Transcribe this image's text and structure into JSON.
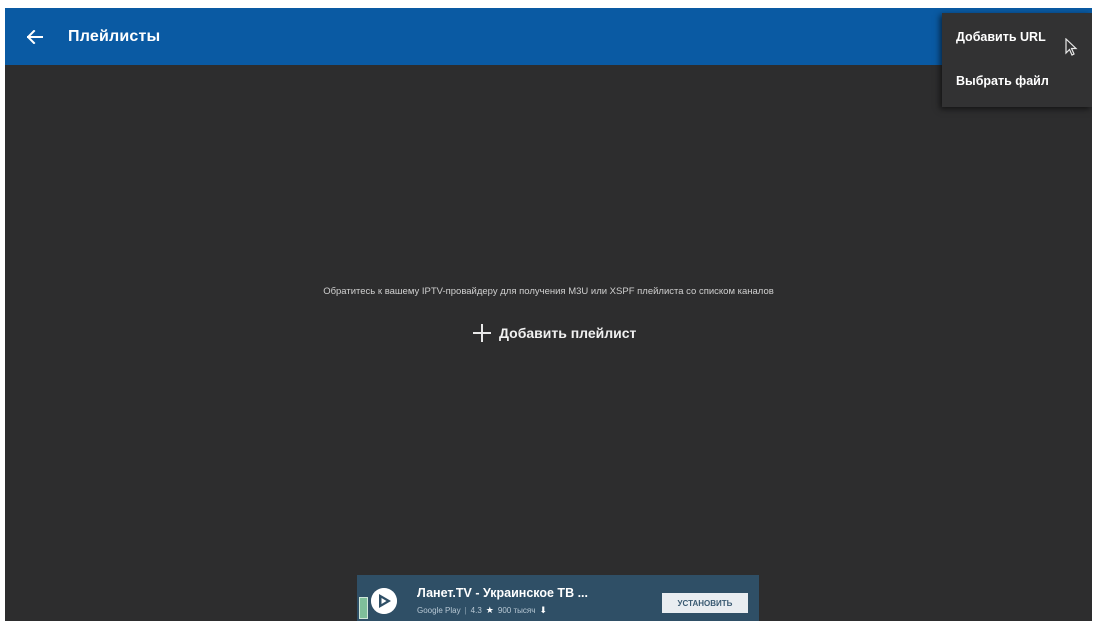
{
  "appbar": {
    "title": "Плейлисты",
    "back_icon": "arrow-left-icon",
    "color": "#0a5aa3"
  },
  "menu": {
    "items": [
      {
        "label": "Добавить URL"
      },
      {
        "label": "Выбрать файл"
      }
    ]
  },
  "main": {
    "hint": "Обратитесь к вашему IPTV-провайдеру для получения M3U или XSPF плейлиста со списком каналов",
    "add_playlist_label": "Добавить плейлист",
    "add_icon": "plus-icon",
    "background": "#2d2d2e"
  },
  "ad": {
    "title": "Ланет.TV - Украинское ТВ ...",
    "store": "Google Play",
    "rating": "4.3",
    "installs": "900 тысяч",
    "install_label": "УСТАНОВИТЬ",
    "background": "#2f4f66"
  }
}
